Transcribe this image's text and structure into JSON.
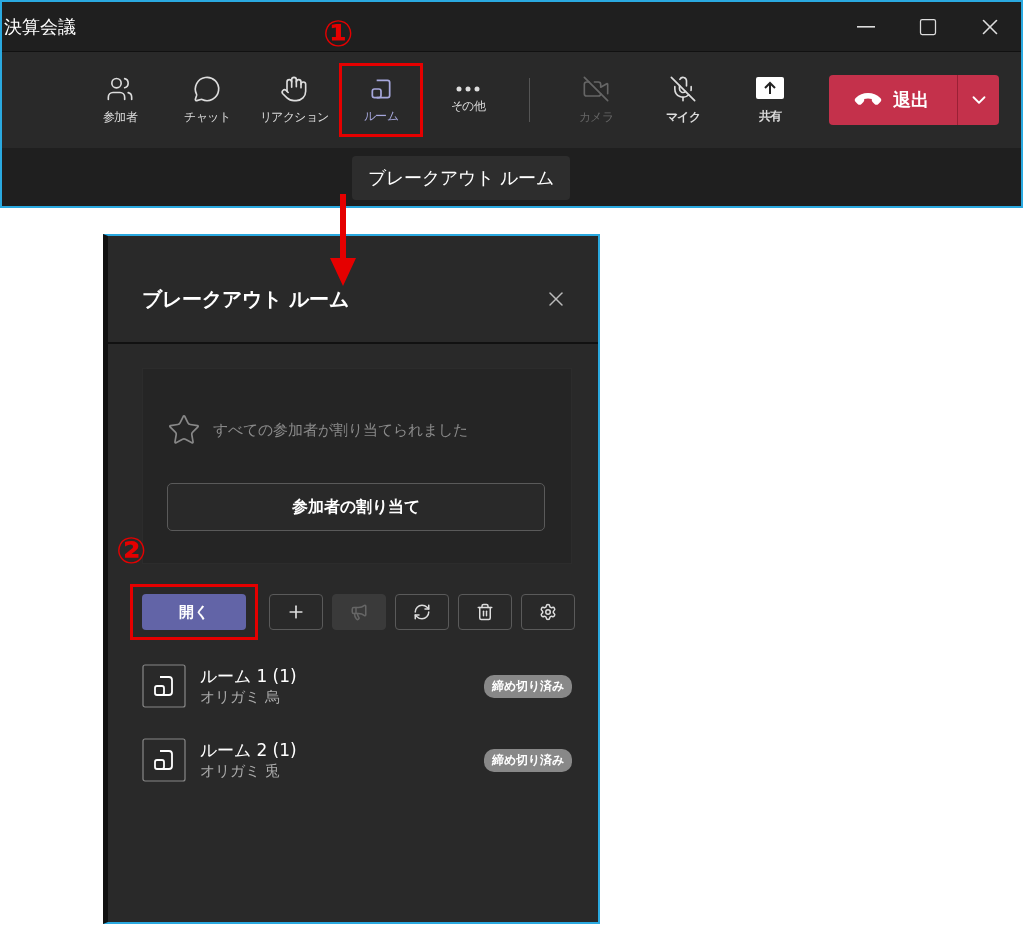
{
  "window": {
    "title": "決算会議"
  },
  "toolbar": {
    "items": [
      {
        "label": "参加者",
        "kind": "people",
        "selected": false,
        "disabled": false,
        "highlighted": false
      },
      {
        "label": "チャット",
        "kind": "chat",
        "selected": false,
        "disabled": false,
        "highlighted": false
      },
      {
        "label": "リアクション",
        "kind": "reaction",
        "selected": false,
        "disabled": false,
        "highlighted": false
      },
      {
        "label": "ルーム",
        "kind": "room",
        "selected": true,
        "disabled": false,
        "highlighted": true
      },
      {
        "label": "その他",
        "kind": "more",
        "selected": false,
        "disabled": false,
        "highlighted": false
      },
      {
        "label": "カメラ",
        "kind": "camera",
        "selected": false,
        "disabled": true,
        "highlighted": false
      },
      {
        "label": "マイク",
        "kind": "mic",
        "selected": false,
        "disabled": false,
        "highlighted": false
      },
      {
        "label": "共有",
        "kind": "share",
        "selected": false,
        "disabled": false,
        "highlighted": false
      }
    ],
    "leave_button": "退出",
    "tooltip": "ブレークアウト ルーム"
  },
  "panel": {
    "title": "ブレークアウト ルーム",
    "message": "すべての参加者が割り当てられました",
    "assign_button": "参加者の割り当て",
    "open_button": {
      "label": "開く",
      "highlighted": true
    },
    "actions": [
      {
        "kind": "add",
        "disabled": false
      },
      {
        "kind": "announce",
        "disabled": true
      },
      {
        "kind": "recreate",
        "disabled": false
      },
      {
        "kind": "delete",
        "disabled": false
      },
      {
        "kind": "settings",
        "disabled": false
      }
    ],
    "rooms": [
      {
        "name": "ルーム 1 (1)",
        "participant": "オリガミ 烏",
        "status": "締め切り済み"
      },
      {
        "name": "ルーム 2 (1)",
        "participant": "オリガミ 兎",
        "status": "締め切り済み"
      }
    ]
  },
  "annotations": [
    {
      "label": "①"
    },
    {
      "label": "②"
    }
  ]
}
